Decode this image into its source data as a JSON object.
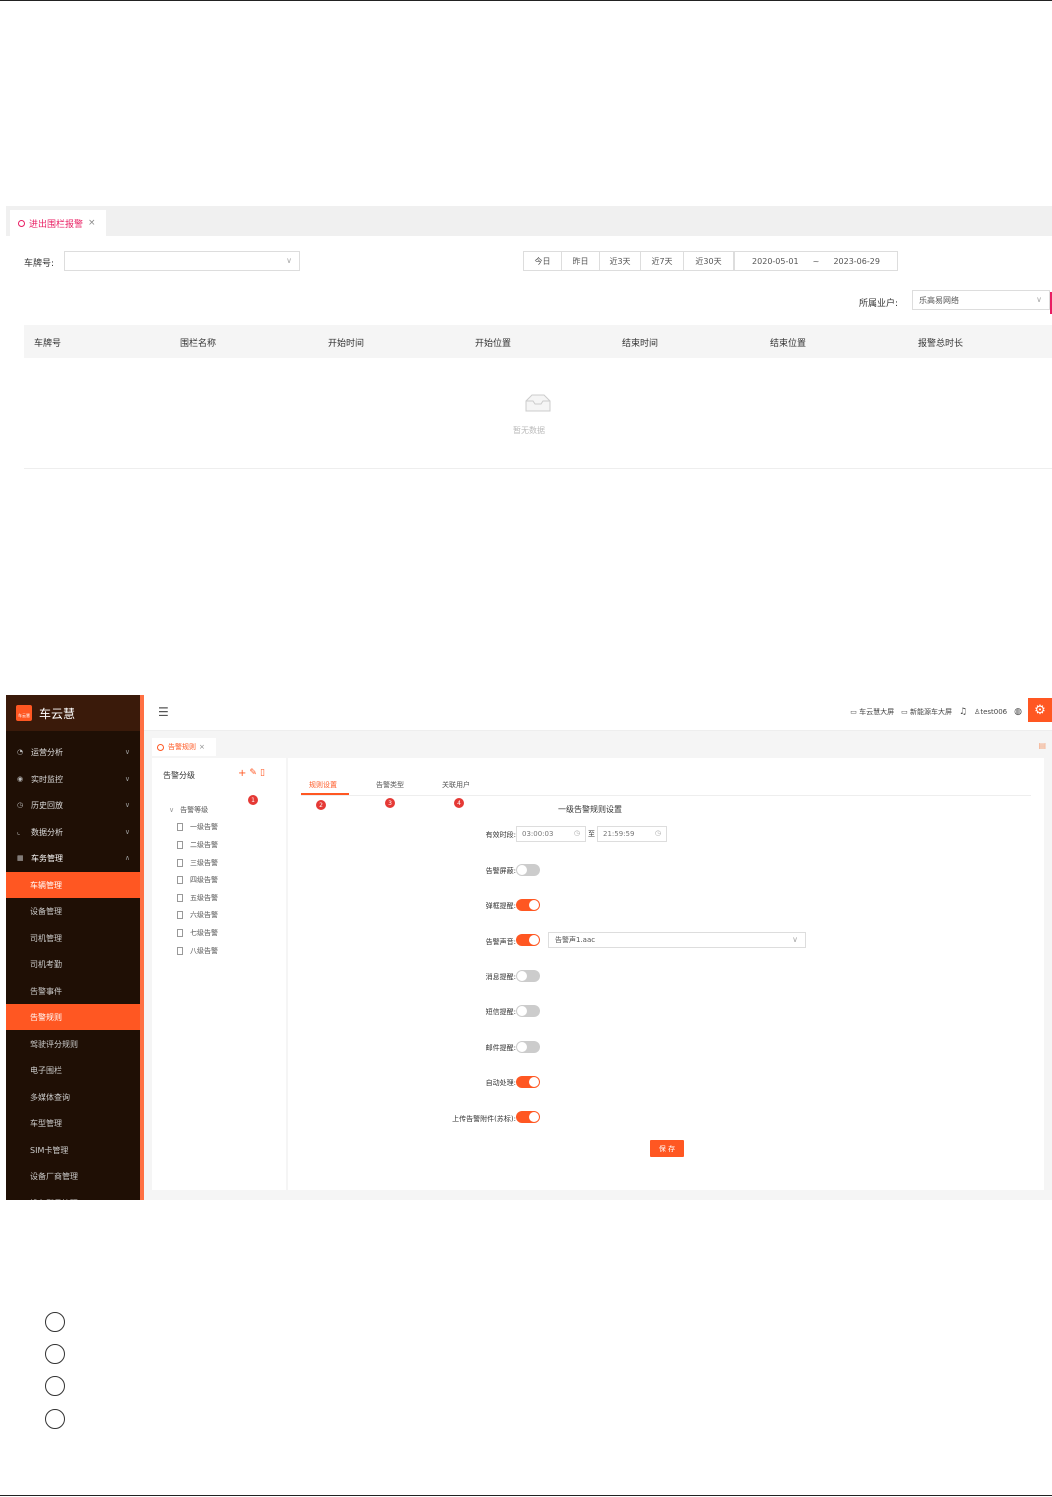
{
  "screenshot1": {
    "tab_label": "进出围栏报警",
    "plate_label": "车牌号:",
    "plate_placeholder": "",
    "quick_ranges": [
      "今日",
      "昨日",
      "近3天",
      "近7天",
      "近30天"
    ],
    "date_start": "2020-05-01",
    "date_sep": "~",
    "date_end": "2023-06-29",
    "owner_label": "所属业户:",
    "owner_value": "乐高易网络",
    "columns": [
      "车牌号",
      "围栏名称",
      "开始时间",
      "开始位置",
      "结束时间",
      "结束位置",
      "报警总时长"
    ],
    "empty_text": "暂无数据"
  },
  "screenshot2": {
    "app_title": "车云慧",
    "logo_text": "车云慧",
    "menu": [
      {
        "label": "运营分析",
        "icon": "gauge-icon",
        "expandable": true
      },
      {
        "label": "实时监控",
        "icon": "eye-icon",
        "expandable": true
      },
      {
        "label": "历史回放",
        "icon": "clock-icon",
        "expandable": true
      },
      {
        "label": "数据分析",
        "icon": "chart-icon",
        "expandable": true
      },
      {
        "label": "车务管理",
        "icon": "grid-icon",
        "expandable": true
      }
    ],
    "submenu": [
      "车辆管理",
      "设备管理",
      "司机管理",
      "司机考勤",
      "告警事件",
      "告警规则",
      "驾驶评分规则",
      "电子围栏",
      "多媒体查询",
      "车型管理",
      "SIM卡管理",
      "设备厂商管理",
      "设备型号管理"
    ],
    "top_links": [
      "车云慧大屏",
      "新能源车大屏"
    ],
    "username": "test006",
    "page_tab": "告警规则",
    "left_title": "告警分级",
    "tree_root": "告警等级",
    "tree_items": [
      "一级告警",
      "二级告警",
      "三级告警",
      "四级告警",
      "五级告警",
      "六级告警",
      "七级告警",
      "八级告警"
    ],
    "tabs": [
      "规则设置",
      "告警类型",
      "关联用户"
    ],
    "badges": [
      "1",
      "2",
      "3",
      "4"
    ],
    "form_title": "一级告警规则设置",
    "valid_period_label": "有效时段:",
    "time_start": "03:00:03",
    "time_to": "至",
    "time_end": "21:59:59",
    "toggles": [
      {
        "label": "告警屏蔽:",
        "on": false
      },
      {
        "label": "弹框提醒:",
        "on": true
      },
      {
        "label": "告警声音:",
        "on": true
      },
      {
        "label": "消息提醒:",
        "on": false
      },
      {
        "label": "短信提醒:",
        "on": false
      },
      {
        "label": "邮件提醒:",
        "on": false
      },
      {
        "label": "自动处理:",
        "on": true
      },
      {
        "label": "上传告警附件(苏标):",
        "on": true
      }
    ],
    "sound_file": "告警声1.aac",
    "save_label": "保 存"
  },
  "colors": {
    "accent": "#ff5722",
    "tab_pink": "#e91e63",
    "sidebar": "#1f0f05",
    "badge": "#e53935"
  }
}
